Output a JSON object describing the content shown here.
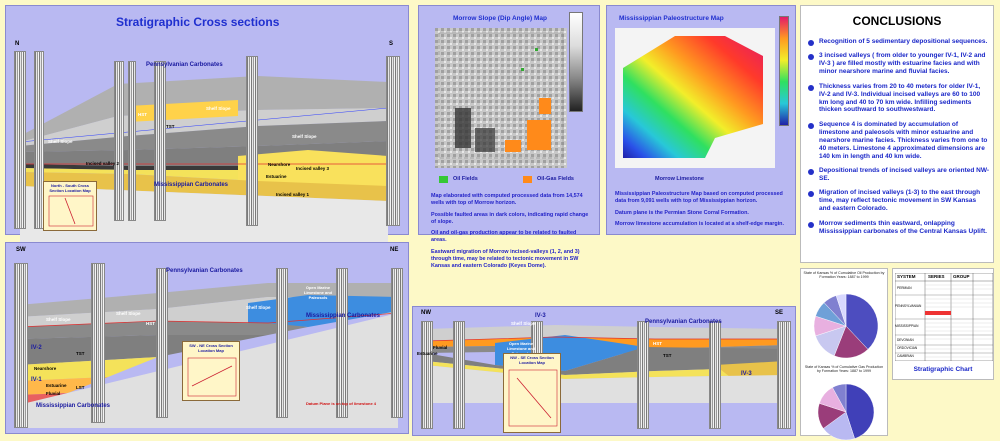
{
  "colors": {
    "background": "#fdf9c7",
    "panel": "#b9b9f2",
    "title": "#1f2fcf",
    "text": "#2424c8",
    "carbonate": "#a8a8a8",
    "shale": "#7f7f7f",
    "sand": "#f7e44a",
    "limestone": "#3d8de0"
  },
  "panel1": {
    "title": "Stratigraphic Cross sections",
    "dir_left": "N",
    "dir_right": "S",
    "labels": {
      "penn": "Pennsylvanian Carbonates",
      "miss": "Mississippian Carbonates",
      "shelf_slope_l": "Shelf Slope",
      "shelf_slope_r": "Shelf Slope",
      "shelf_slope_c": "Shelf Slope",
      "hst": "HST",
      "tst": "TST",
      "estuarine": "Estuarine",
      "nearshore": "Nearshore",
      "incised1": "Incised valley 1",
      "incised2": "Incised valley 2",
      "incised3": "Incised valley 3"
    },
    "loc_map": "North - South Cross Section Location Map"
  },
  "panel2": {
    "title": "Morrow Slope (Dip Angle) Map",
    "legend_oil": "Oil Fields",
    "legend_gas": "Oil-Gas Fields",
    "paragraphs": [
      "Map elaborated with computed processed data from 14,574 wells with top of Morrow horizon.",
      "Possible faulted areas in dark colors, indicating rapid change of slope.",
      "Oil and oil-gas production appear to be related to faulted areas.",
      "Eastward migration of Morrow incised-valleys (1, 2, and 3) through time, may be related to tectonic movement in SW Kansas and eastern Colorado (Keyes Dome)."
    ]
  },
  "panel3": {
    "title": "Mississippian Paleostructure Map",
    "map_label": "Morrow Limestone",
    "paragraphs": [
      "Mississippian Paleostructure Map based on computed processed data from 9,091 wells with top of Mississippian horizon.",
      "Datum plane is the Permian Stone Corral Formation.",
      "Morrow limestone accumulation is located at a shelf-edge margin."
    ]
  },
  "conclusions": {
    "title": "CONCLUSIONS",
    "items": [
      "Recognition of 5 sedimentary depositional sequences.",
      "3 incised valleys ( from older to younger IV-1, IV-2 and IV-3 ) are filled mostly with estuarine facies and with minor nearshore marine and fluvial facies.",
      "Thickness varies from 20 to 40 meters for older IV-1, IV-2 and IV-3. Individual incised valleys are 60 to 100 km long and 40 to 70 km wide. Infilling sediments thicken southward to southwestward.",
      "Sequence 4 is dominated by accumulation of limestone and paleosols with minor estuarine and nearshore marine facies. Thickness varies from one to 40 meters. Limestone 4 approximated dimensions are 140 km in length and 40 km wide.",
      "Depositional trends of incised valleys are oriented NW-SE.",
      "Migration of incised valleys (1-3) to the east through time, may reflect tectonic movement in SW Kansas and eastern Colorado.",
      "Morrow sediments thin eastward, onlapping Mississippian carbonates of the Central Kansas Uplift."
    ]
  },
  "panel4": {
    "dir_left": "SW",
    "dir_right": "NE",
    "labels": {
      "penn": "Pennsylvanian Carbonates",
      "miss": "Mississippian Carbonates",
      "miss2": "Mississippian Carbonates",
      "shelf_slope1": "Shelf Slope",
      "shelf_slope2": "Shelf Slope",
      "shelf_slope3": "Shelf Slope",
      "open_marine": "Open Marine Limestone and Paleosols",
      "iv2": "IV-2",
      "iv1": "IV-1",
      "nearshore": "Nearshore",
      "estuarine": "Estuarine",
      "fluvial": "Fluvial",
      "tst": "TST",
      "hst": "HST",
      "lst": "LST",
      "datum": "Datum Plane is on top of limestone 4"
    },
    "loc_map": "SW - NE Cross Section Location Map"
  },
  "panel5": {
    "dir_left": "NW",
    "dir_right": "SE",
    "labels": {
      "penn": "Pennsylvanian Carbonates",
      "shelf_slope": "Shelf Slope",
      "iv3": "IV-3",
      "iv3b": "IV-3",
      "open_marine": "Open Marine Limestone and Paleosols",
      "estuarine": "Estuarine",
      "fluvial": "Fluvial",
      "hst": "HST",
      "tst": "TST"
    },
    "loc_map": "NW - SE Cross Section Location Map"
  },
  "pies": {
    "top_title": "State of Kansas % of Cumulative Oil Production by Formation Years: 1887 to 1999",
    "bottom_title": "State of Kansas % of Cumulative Gas Production by Formation Years: 1887 to 1999",
    "top_slices": [
      {
        "pct": 38,
        "color": "#4d4dbf"
      },
      {
        "pct": 18,
        "color": "#9a3d7a"
      },
      {
        "pct": 14,
        "color": "#c8c8f0"
      },
      {
        "pct": 10,
        "color": "#e8b0e0"
      },
      {
        "pct": 8,
        "color": "#6fa0d8"
      },
      {
        "pct": 7,
        "color": "#8080d0"
      },
      {
        "pct": 5,
        "color": "#d8d8ff"
      }
    ],
    "bottom_slices": [
      {
        "pct": 45,
        "color": "#4040b8"
      },
      {
        "pct": 20,
        "color": "#b9b9f2"
      },
      {
        "pct": 15,
        "color": "#9a3d7a"
      },
      {
        "pct": 12,
        "color": "#e8b0e0"
      },
      {
        "pct": 8,
        "color": "#8080d0"
      }
    ]
  },
  "strat_chart": {
    "caption": "Stratigraphic Chart",
    "headers": [
      "SYSTEM",
      "SERIES",
      "GROUP"
    ],
    "systems": [
      "PERMIAN",
      "PENNSYLVANIAN",
      "MISSISSIPPIAN",
      "DEVONIAN",
      "ORDOVICIAN",
      "CAMBRIAN"
    ]
  }
}
